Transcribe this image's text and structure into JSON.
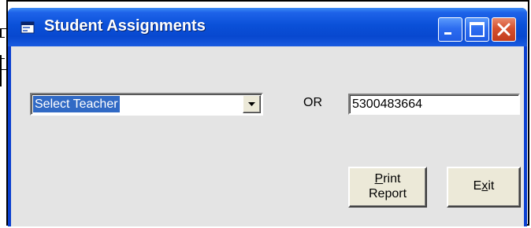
{
  "window": {
    "title": "Student Assignments",
    "icon": "form-window-icon",
    "controls": {
      "minimize_icon": "minimize-icon",
      "maximize_icon": "maximize-icon",
      "close_icon": "close-icon"
    },
    "colors": {
      "titlebar": "#0a50d8",
      "client_background": "#e4e4e4",
      "close_button": "#d6512f",
      "selection": "#316ac5"
    }
  },
  "form": {
    "teacher_select": {
      "selected": "Select Teacher",
      "dropdown_icon": "chevron-down-icon"
    },
    "or_label": "OR",
    "id_field": {
      "value": "5300483664"
    },
    "print_button": {
      "mnemonic": "P",
      "line1_rest": "rint",
      "line2": "Report"
    },
    "exit_button": {
      "before": "E",
      "mnemonic": "x",
      "after": "it"
    }
  }
}
